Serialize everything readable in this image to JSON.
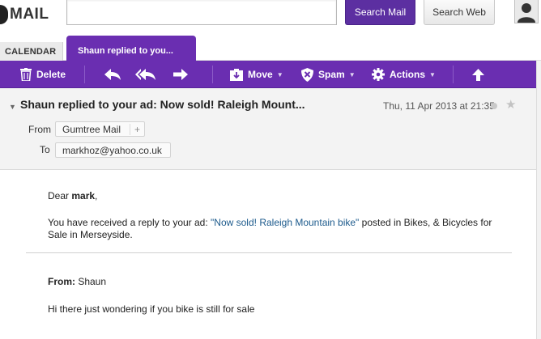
{
  "header": {
    "logo_text": "MAIL",
    "search_value": "",
    "search_mail_label": "Search Mail",
    "search_web_label": "Search Web"
  },
  "tabs": {
    "calendar_label": "CALENDAR",
    "message_label": "Shaun replied to you..."
  },
  "toolbar": {
    "delete_label": "Delete",
    "move_label": "Move",
    "spam_label": "Spam",
    "actions_label": "Actions",
    "icons": [
      "trash-icon",
      "reply-icon",
      "reply-all-icon",
      "forward-icon",
      "move-icon",
      "spam-shield-icon",
      "gear-icon",
      "up-arrow-icon"
    ]
  },
  "message": {
    "subject": "Shaun replied to your ad: Now sold! Raleigh Mount...",
    "date": "Thu, 11 Apr 2013 at 21:35",
    "from_label": "From",
    "from_value": "Gumtree Mail",
    "to_label": "To",
    "to_value": "markhoz@yahoo.co.uk",
    "body": {
      "greeting_prefix": "Dear ",
      "greeting_name": "mark",
      "greeting_suffix": ",",
      "para_prefix": "You have received a reply to your ad: ",
      "ad_link": "\"Now sold! Raleigh Mountain bike\"",
      "para_suffix": " posted in Bikes, & Bicycles for Sale in Merseyside.",
      "from_label": "From:",
      "from_name": " Shaun",
      "reply_text": "Hi there just wondering if you bike is still for sale"
    }
  },
  "colors": {
    "brand_purple": "#6a2eb1",
    "search_button": "#5c2fa1",
    "link": "#1c5a8c"
  }
}
